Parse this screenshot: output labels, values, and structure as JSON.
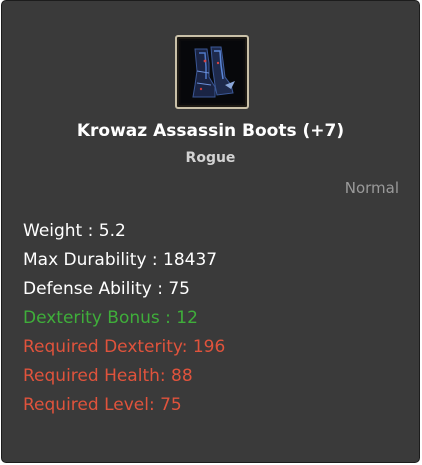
{
  "item": {
    "name": "Krowaz Assassin Boots (+7)",
    "class": "Rogue",
    "rarity": "Normal",
    "icon": "assassin-boots-icon"
  },
  "stats": [
    {
      "text": "Weight : 5.2",
      "color": "#ffffff"
    },
    {
      "text": "Max Durability : 18437",
      "color": "#ffffff"
    },
    {
      "text": "Defense Ability : 75",
      "color": "#ffffff"
    },
    {
      "text": "Dexterity Bonus : 12",
      "color": "#3fae3a"
    },
    {
      "text": "Required Dexterity: 196",
      "color": "#e0533c"
    },
    {
      "text": "Required Health: 88",
      "color": "#e0533c"
    },
    {
      "text": "Required Level: 75",
      "color": "#e0533c"
    }
  ]
}
